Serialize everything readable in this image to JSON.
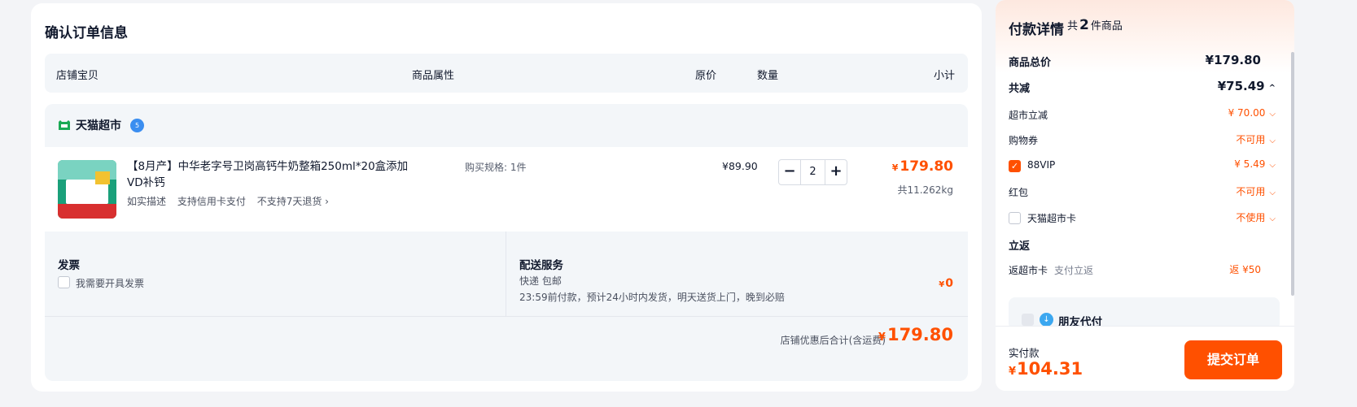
{
  "order": {
    "title": "确认订单信息",
    "columns": {
      "store_item": "店铺宝贝",
      "attributes": "商品属性",
      "price": "原价",
      "quantity": "数量",
      "subtotal": "小计"
    }
  },
  "store": {
    "name": "天猫超市",
    "badge": "5",
    "item": {
      "title": "【8月产】中华老字号卫岗高钙牛奶整箱250ml*20盒添加VD补钙",
      "tags": [
        "如实描述",
        "支持信用卡支付",
        "不支持7天退货 ›"
      ],
      "attribute": "购买规格: 1件",
      "price": "¥89.90",
      "qty": "2",
      "minus": "−",
      "plus": "+",
      "subtotal_currency": "¥",
      "subtotal": "179.80",
      "weight": "共11.262kg"
    },
    "invoice": {
      "title": "发票",
      "checkbox_label": "我需要开具发票"
    },
    "delivery": {
      "title": "配送服务",
      "line1": "快递 包邮",
      "line2": "23:59前付款，预计24小时内发货，明天送货上门，晚到必赔",
      "fee_currency": "¥",
      "fee": "0"
    },
    "total_label": "店铺优惠后合计(含运费)",
    "total_currency": "¥",
    "total": "179.80"
  },
  "payment": {
    "title": "付款详情",
    "count_prefix": "共",
    "count": "2",
    "count_suffix": "件商品",
    "goods_total_label": "商品总价",
    "goods_total": "¥179.80",
    "discount_label": "共减",
    "discount": "¥75.49",
    "discount_chev": "^",
    "supermarket_off_label": "超市立减",
    "supermarket_off": "¥ 70.00",
    "coupon_label": "购物券",
    "coupon": "不可用",
    "vip_label": "88VIP",
    "vip": "¥ 5.49",
    "redpacket_label": "红包",
    "redpacket": "不可用",
    "tmall_card_label": "天猫超市卡",
    "tmall_card": "不使用",
    "rebate_title": "立返",
    "rebate_label": "返超市卡",
    "rebate_sub": "支付立返",
    "rebate": "返 ¥50",
    "friend_pay_label": "朋友代付",
    "paid_label": "实付款",
    "paid_currency": "¥",
    "paid": "104.31",
    "submit_label": "提交订单"
  },
  "colors": {
    "accent": "#ff5000",
    "panel": "#f3f6f9",
    "text": "#11192d"
  }
}
